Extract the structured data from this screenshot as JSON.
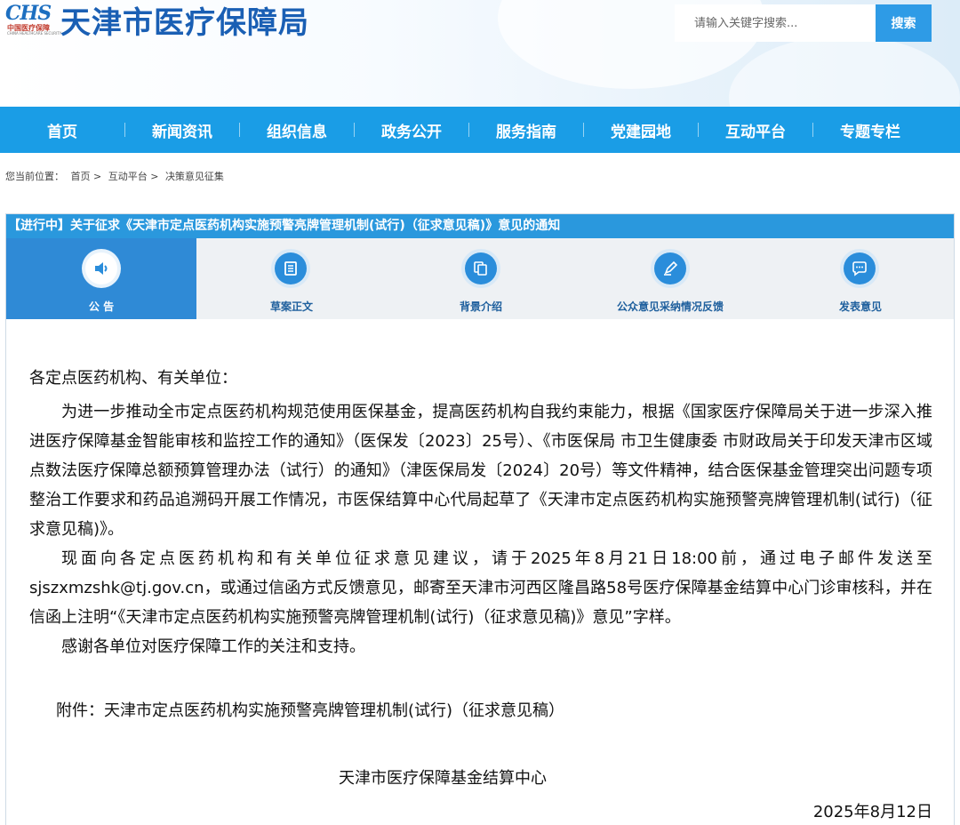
{
  "header": {
    "logo_mark": "CHS",
    "logo_sub": "中国医疗保障",
    "logo_sub_en": "CHINA HEALTHCARE SECURITY",
    "site_title": "天津市医疗保障局",
    "search_placeholder": "请输入关键字搜索...",
    "search_button": "搜索"
  },
  "nav": {
    "items": [
      "首页",
      "新闻资讯",
      "组织信息",
      "政务公开",
      "服务指南",
      "党建园地",
      "互动平台",
      "专题专栏"
    ]
  },
  "breadcrumb": {
    "label": "您当前位置：",
    "items": [
      "首页 >",
      "互动平台 >",
      "决策意见征集"
    ]
  },
  "panel": {
    "title": "【进行中】关于征求《天津市定点医药机构实施预警亮牌管理机制(试行)（征求意见稿)》意见的通知",
    "tabs": [
      {
        "label": "公  告",
        "icon": "speaker-icon"
      },
      {
        "label": "草案正文",
        "icon": "document-icon"
      },
      {
        "label": "背景介绍",
        "icon": "copy-icon"
      },
      {
        "label": "公众意见采纳情况反馈",
        "icon": "pen-icon"
      },
      {
        "label": "发表意见",
        "icon": "chat-icon"
      }
    ]
  },
  "content": {
    "greeting": "各定点医药机构、有关单位：",
    "para1": "为进一步推动全市定点医药机构规范使用医保基金，提高医药机构自我约束能力，根据《国家医疗保障局关于进一步深入推进医疗保障基金智能审核和监控工作的通知》（医保发〔2023〕25号）、《市医保局 市卫生健康委 市财政局关于印发天津市区域点数法医疗保障总额预算管理办法（试行）的通知》（津医保局发〔2024〕20号）等文件精神，结合医保基金管理突出问题专项整治工作要求和药品追溯码开展工作情况，市医保结算中心代局起草了《天津市定点医药机构实施预警亮牌管理机制(试行)（征求意见稿)》。",
    "para2": "现面向各定点医药机构和有关单位征求意见建议，请于2025年8月21日18:00前，通过电子邮件发送至sjszxmzshk@tj.gov.cn，或通过信函方式反馈意见，邮寄至天津市河西区隆昌路58号医疗保障基金结算中心门诊审核科，并在信函上注明“《天津市定点医药机构实施预警亮牌管理机制(试行)（征求意见稿)》意见”字样。",
    "para3": "感谢各单位对医疗保障工作的关注和支持。",
    "attachment": "附件：天津市定点医药机构实施预警亮牌管理机制(试行)（征求意见稿）",
    "signer": "天津市医疗保障基金结算中心",
    "date": "2025年8月12日"
  },
  "colors": {
    "nav": "#1a9de6",
    "panel_title": "#2a98dd",
    "active_tab": "#2f8ad6",
    "brand": "#1a5fb4"
  }
}
